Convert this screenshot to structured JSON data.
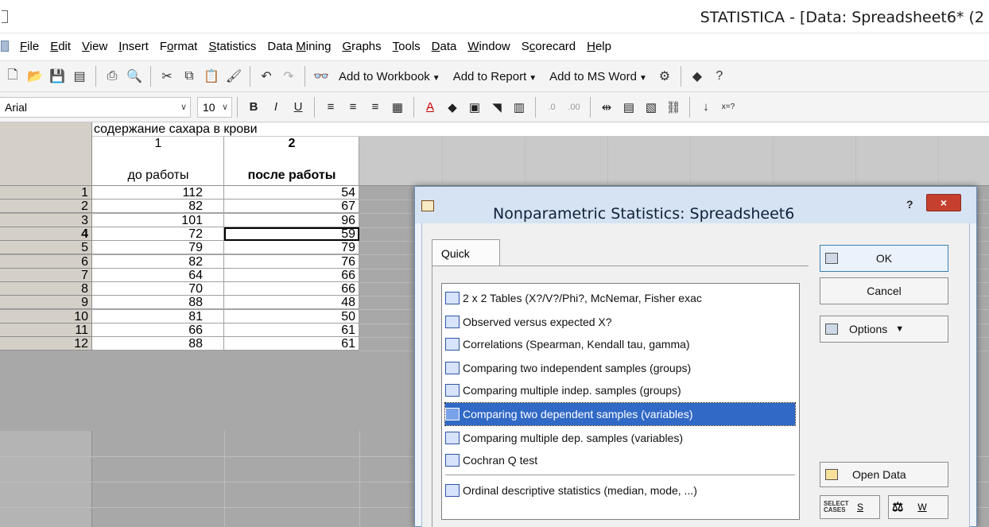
{
  "window": {
    "title": "STATISTICA - [Data: Spreadsheet6* (2"
  },
  "menu": [
    "File",
    "Edit",
    "View",
    "Insert",
    "Format",
    "Statistics",
    "Data Mining",
    "Graphs",
    "Tools",
    "Data",
    "Window",
    "Scorecard",
    "Help"
  ],
  "menu_accel": [
    "F",
    "E",
    "V",
    "I",
    "o",
    "S",
    "M",
    "G",
    "T",
    "D",
    "W",
    "c",
    "H"
  ],
  "toolbar": {
    "add_workbook": "Add to Workbook",
    "add_report": "Add to Report",
    "add_word": "Add to MS Word"
  },
  "format_bar": {
    "font": "Arial",
    "size": "10"
  },
  "spreadsheet": {
    "group_header": "содержание сахара в крови",
    "columns": [
      {
        "number": "1",
        "name": "до работы"
      },
      {
        "number": "2",
        "name": "после работы"
      }
    ],
    "rows": [
      {
        "n": "1",
        "a": "112",
        "b": "54"
      },
      {
        "n": "2",
        "a": "82",
        "b": "67"
      },
      {
        "n": "3",
        "a": "101",
        "b": "96"
      },
      {
        "n": "4",
        "a": "72",
        "b": "59"
      },
      {
        "n": "5",
        "a": "79",
        "b": "79"
      },
      {
        "n": "6",
        "a": "82",
        "b": "76"
      },
      {
        "n": "7",
        "a": "64",
        "b": "66"
      },
      {
        "n": "8",
        "a": "70",
        "b": "66"
      },
      {
        "n": "9",
        "a": "88",
        "b": "48"
      },
      {
        "n": "10",
        "a": "81",
        "b": "50"
      },
      {
        "n": "11",
        "a": "66",
        "b": "61"
      },
      {
        "n": "12",
        "a": "88",
        "b": "61"
      }
    ],
    "active_row": "4"
  },
  "dialog": {
    "title": "Nonparametric Statistics: Spreadsheet6",
    "help": "?",
    "close": "×",
    "tab": "Quick",
    "items": [
      "2 x 2 Tables (X?/V?/Phi?, McNemar, Fisher exac",
      "Observed versus expected X?",
      "Correlations (Spearman, Kendall tau, gamma)",
      "Comparing two independent samples (groups)",
      "Comparing multiple indep. samples (groups)",
      "Comparing two dependent samples (variables)",
      "Comparing multiple dep. samples (variables)",
      "Cochran Q test",
      "Ordinal descriptive statistics (median, mode, ...)"
    ],
    "selected_item": "Comparing two dependent samples (variables)",
    "buttons": {
      "ok": "OK",
      "cancel": "Cancel",
      "options": "Options",
      "open_data": "Open Data",
      "select_cases_label": "SELECT CASES",
      "s": "S",
      "w": "W"
    }
  }
}
